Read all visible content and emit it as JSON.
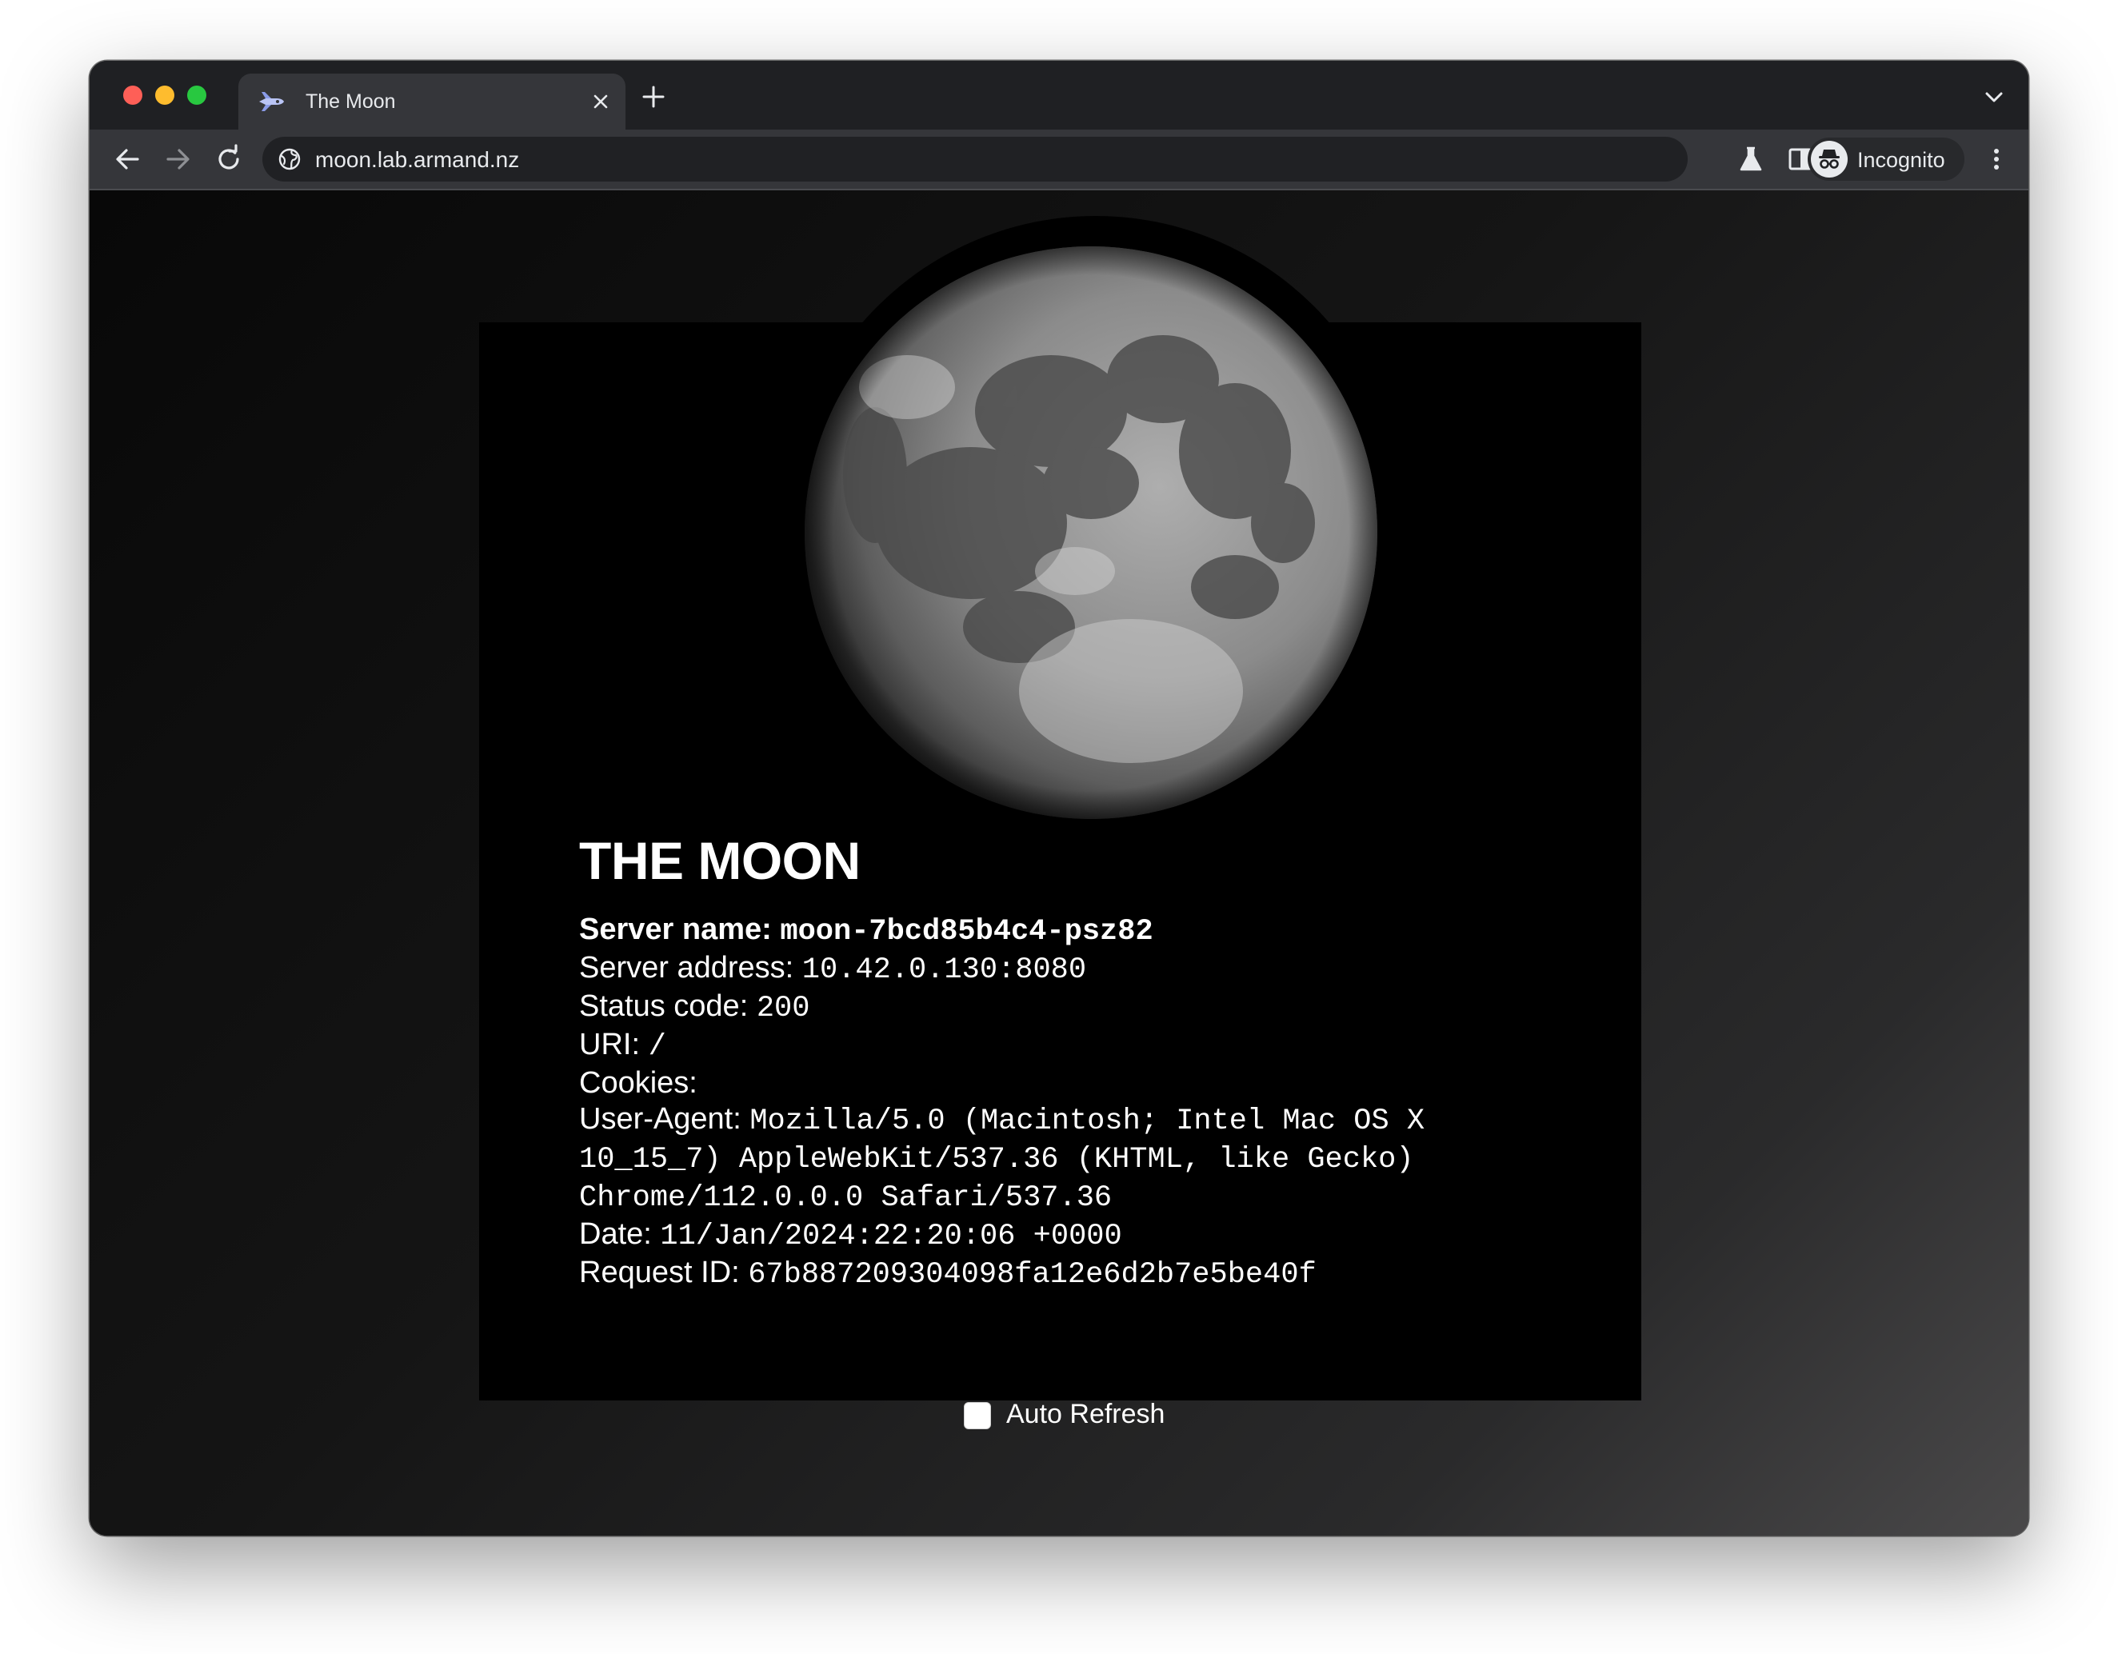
{
  "browser": {
    "tab_title": "The Moon",
    "url": "moon.lab.armand.nz",
    "incognito_label": "Incognito",
    "icons": {
      "favicon": "rocket-icon",
      "close": "close-icon",
      "new_tab": "plus-icon",
      "tab_search": "chevron-down-icon",
      "back": "back-arrow-icon",
      "forward": "forward-arrow-icon",
      "reload": "reload-icon",
      "site_info": "globe-icon",
      "labs": "flask-icon",
      "side_panel": "side-panel-icon",
      "incognito": "incognito-icon",
      "menu": "kebab-menu-icon"
    }
  },
  "page": {
    "title": "THE MOON",
    "fields": {
      "server_name": {
        "label": "Server name:",
        "value": "moon-7bcd85b4c4-psz82"
      },
      "server_address": {
        "label": "Server address:",
        "value": "10.42.0.130:8080"
      },
      "status_code": {
        "label": "Status code:",
        "value": "200"
      },
      "uri": {
        "label": "URI:",
        "value": "/"
      },
      "cookies": {
        "label": "Cookies:",
        "value": ""
      },
      "user_agent": {
        "label": "User-Agent:",
        "line1": "Mozilla/5.0 (Macintosh; Intel Mac OS X",
        "line2": "10_15_7) AppleWebKit/537.36 (KHTML, like Gecko)",
        "line3": "Chrome/112.0.0.0 Safari/537.36"
      },
      "date": {
        "label": "Date:",
        "value": "11/Jan/2024:22:20:06 +0000"
      },
      "request_id": {
        "label": "Request ID:",
        "value": "67b887209304098fa12e6d2b7e5be40f"
      }
    },
    "auto_refresh": {
      "label": "Auto Refresh",
      "checked": false
    }
  },
  "colors": {
    "page_background": "#000000",
    "text": "#ffffff",
    "tab_active": "#35363a",
    "tab_strip": "#1f2023",
    "omnibox": "#202124"
  }
}
